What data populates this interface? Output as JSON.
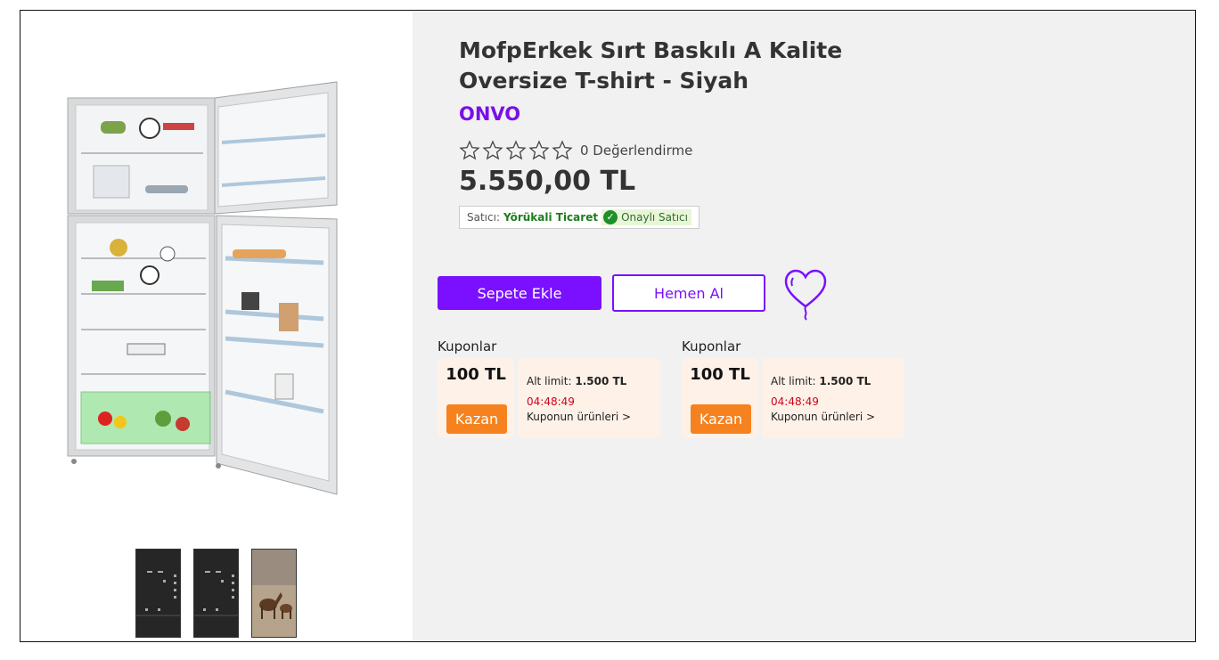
{
  "product": {
    "title": "MofpErkek Sırt Baskılı A Kalite Oversize T-shirt - Siyah",
    "brand": "ONVO",
    "rating_count_text": "0 Değerlendirme",
    "stars_filled": 0,
    "stars_total": 5,
    "price": "5.550,00 TL"
  },
  "seller": {
    "label": "Satıcı:",
    "name": "Yörükali Ticaret",
    "verified_label": "Onaylı Satıcı"
  },
  "actions": {
    "add_to_cart": "Sepete Ekle",
    "buy_now": "Hemen Al",
    "favorite_icon": "heart-balloon-icon"
  },
  "coupons": [
    {
      "heading": "Kuponlar",
      "amount": "100 TL",
      "button": "Kazan",
      "limit_label": "Alt limit:",
      "limit_value": "1.500 TL",
      "timer": "04:48:49",
      "link": "Kuponun ürünleri >"
    },
    {
      "heading": "Kuponlar",
      "amount": "100 TL",
      "button": "Kazan",
      "limit_label": "Alt limit:",
      "limit_value": "1.500 TL",
      "timer": "04:48:49",
      "link": "Kuponun ürünleri >"
    }
  ],
  "gallery": {
    "main_image": "refrigerator-open",
    "thumbnails": [
      "refrigerator-black-front",
      "refrigerator-black-front",
      "horses-photo"
    ]
  },
  "colors": {
    "accent": "#7a10ff",
    "brand": "#7a10e8",
    "coupon_button": "#f5821f",
    "coupon_bg": "#fdf1e8",
    "timer": "#d0021b",
    "seller_name": "#1c7d1c",
    "panel_bg": "#f1f1f1"
  }
}
